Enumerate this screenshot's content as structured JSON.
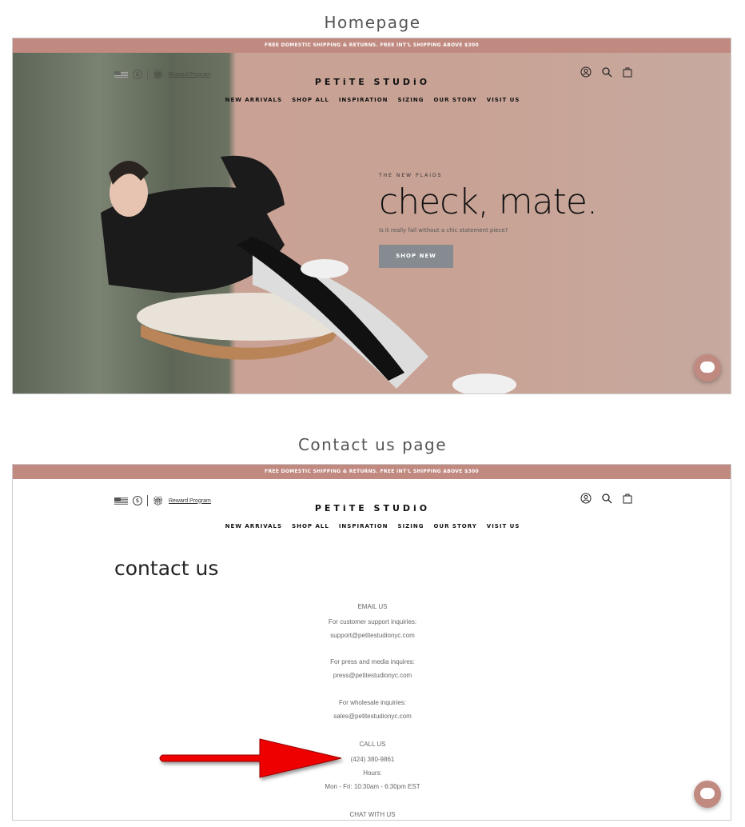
{
  "sections": {
    "home_title": "Homepage",
    "contact_title": "Contact us page"
  },
  "banner": "FREE DOMESTIC SHIPPING & RETURNS. FREE INT'L SHIPPING ABOVE $300",
  "header": {
    "currency": "$",
    "reward": "Reward Program",
    "logo": "PETiTE STUDiO",
    "nav": [
      "NEW ARRIVALS",
      "SHOP ALL",
      "INSPIRATION",
      "SIZING",
      "OUR STORY",
      "VISIT US"
    ]
  },
  "hero": {
    "eyebrow": "THE NEW PLAIDS",
    "headline": "check, mate.",
    "sub": "Is it really fall without a chic statement piece?",
    "cta": "SHOP NEW"
  },
  "contact": {
    "title": "contact us",
    "email_heading": "EMAIL US",
    "lines": [
      "For customer support inquiries:",
      "support@petitestudionyc.com",
      "For press and media inquires:",
      "press@petitestudionyc.com",
      "For wholesale inquiries:",
      "sales@petitestudionyc.com"
    ],
    "call_heading": "CALL US",
    "phone": "(424) 380-9861",
    "hours_label": "Hours:",
    "hours": "Mon - Fri: 10:30am - 6:30pm EST",
    "chat_heading": "CHAT WITH US"
  },
  "colors": {
    "banner": "#c08a80",
    "accent": "#d9534f",
    "arrow": "#ee0000"
  }
}
